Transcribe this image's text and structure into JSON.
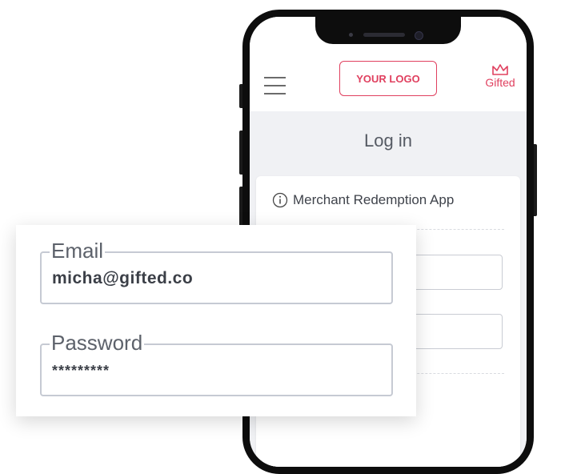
{
  "header": {
    "logo_placeholder": "YOUR LOGO",
    "brand_name": "Gifted"
  },
  "page": {
    "heading": "Log in",
    "card_title": "Merchant Redemption App"
  },
  "login_zoom": {
    "email_label": "Email",
    "email_value": "micha@gifted.co",
    "password_label": "Password",
    "password_value": "*********"
  },
  "colors": {
    "accent": "#e0405f",
    "body_bg": "#f0f1f4",
    "field_border": "#c6cad3"
  }
}
